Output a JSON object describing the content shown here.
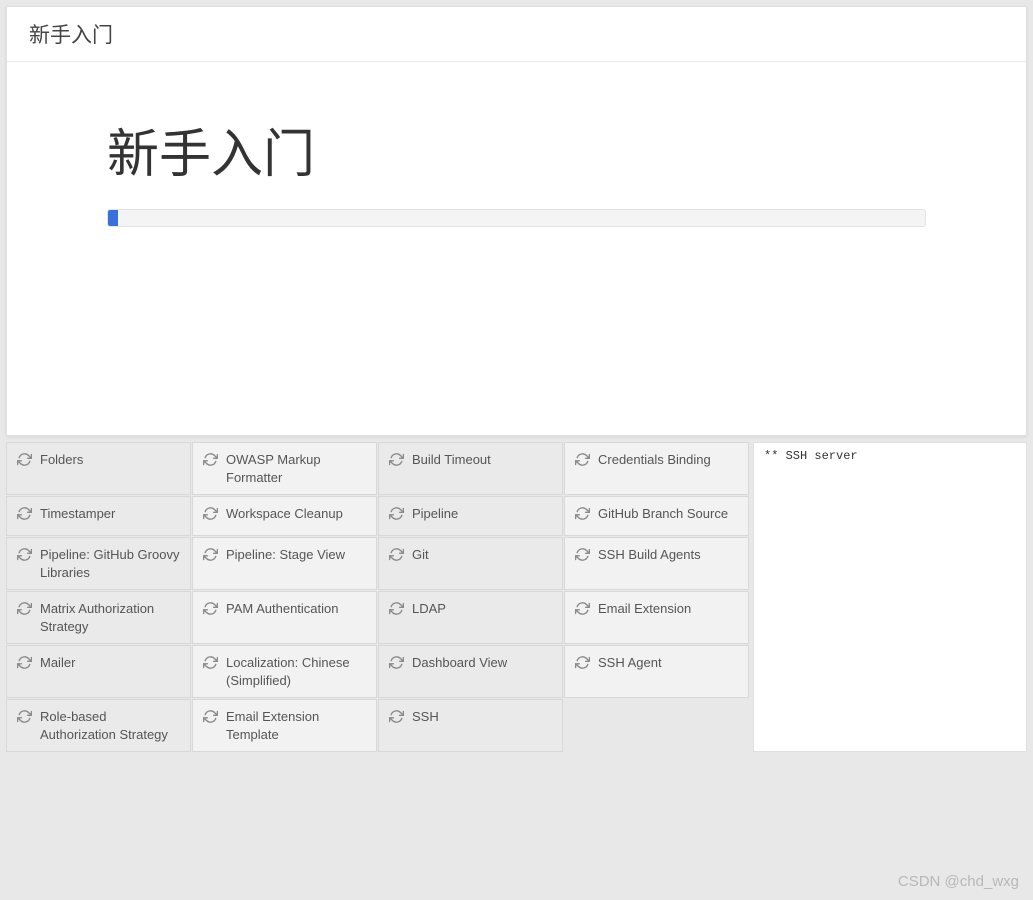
{
  "header": {
    "label": "新手入门"
  },
  "main": {
    "title": "新手入门",
    "progress_percent": 1
  },
  "plugins": [
    {
      "label": "Folders",
      "light": false
    },
    {
      "label": "OWASP Markup Formatter",
      "light": true
    },
    {
      "label": "Build Timeout",
      "light": false
    },
    {
      "label": "Credentials Binding",
      "light": true
    },
    {
      "label": "Timestamper",
      "light": false
    },
    {
      "label": "Workspace Cleanup",
      "light": true
    },
    {
      "label": "Pipeline",
      "light": false
    },
    {
      "label": "GitHub Branch Source",
      "light": true
    },
    {
      "label": "Pipeline: GitHub Groovy Libraries",
      "light": false
    },
    {
      "label": "Pipeline: Stage View",
      "light": true
    },
    {
      "label": "Git",
      "light": false
    },
    {
      "label": "SSH Build Agents",
      "light": true
    },
    {
      "label": "Matrix Authorization Strategy",
      "light": false
    },
    {
      "label": "PAM Authentication",
      "light": true
    },
    {
      "label": "LDAP",
      "light": false
    },
    {
      "label": "Email Extension",
      "light": true
    },
    {
      "label": "Mailer",
      "light": false
    },
    {
      "label": "Localization: Chinese (Simplified)",
      "light": true
    },
    {
      "label": "Dashboard View",
      "light": false
    },
    {
      "label": "SSH Agent",
      "light": true
    },
    {
      "label": "Role-based Authorization Strategy",
      "light": false
    },
    {
      "label": "Email Extension Template",
      "light": true
    },
    {
      "label": "SSH",
      "light": false
    }
  ],
  "log": {
    "text": "** SSH server"
  },
  "watermark": "CSDN @chd_wxg"
}
